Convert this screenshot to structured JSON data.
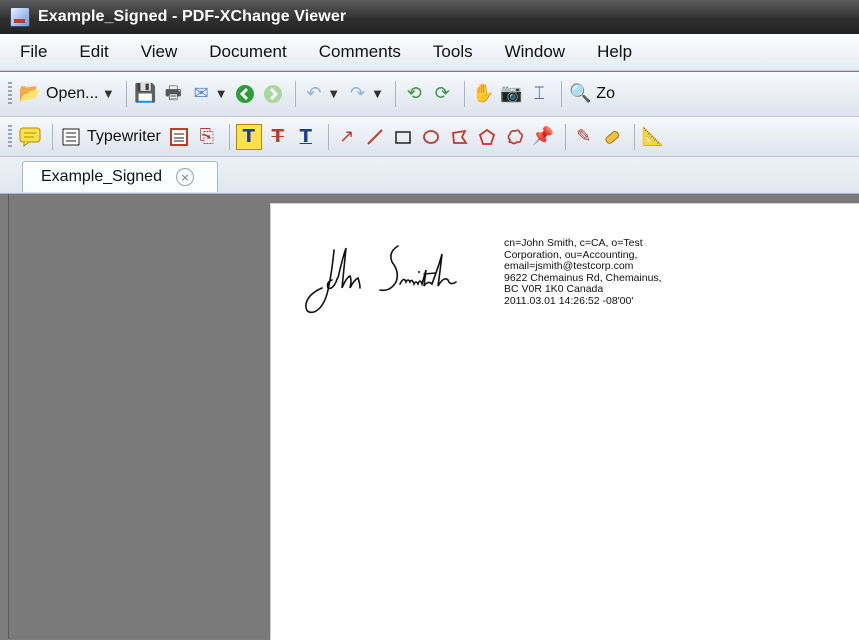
{
  "window": {
    "title": "Example_Signed - PDF-XChange Viewer"
  },
  "menu": [
    "File",
    "Edit",
    "View",
    "Document",
    "Comments",
    "Tools",
    "Window",
    "Help"
  ],
  "toolbar": {
    "open_label": "Open...",
    "zoom_label_partial": "Zo",
    "typewriter_label": "Typewriter"
  },
  "tab": {
    "label": "Example_Signed",
    "close": "×"
  },
  "signature": {
    "handwritten_name": "John Smith",
    "details": [
      "cn=John Smith, c=CA, o=Test",
      "Corporation, ou=Accounting,",
      "email=jsmith@testcorp.com",
      "9622 Chemainus Rd, Chemainus,",
      "BC V0R 1K0 Canada",
      "2011.03.01 14:26:52 -08'00'"
    ]
  }
}
